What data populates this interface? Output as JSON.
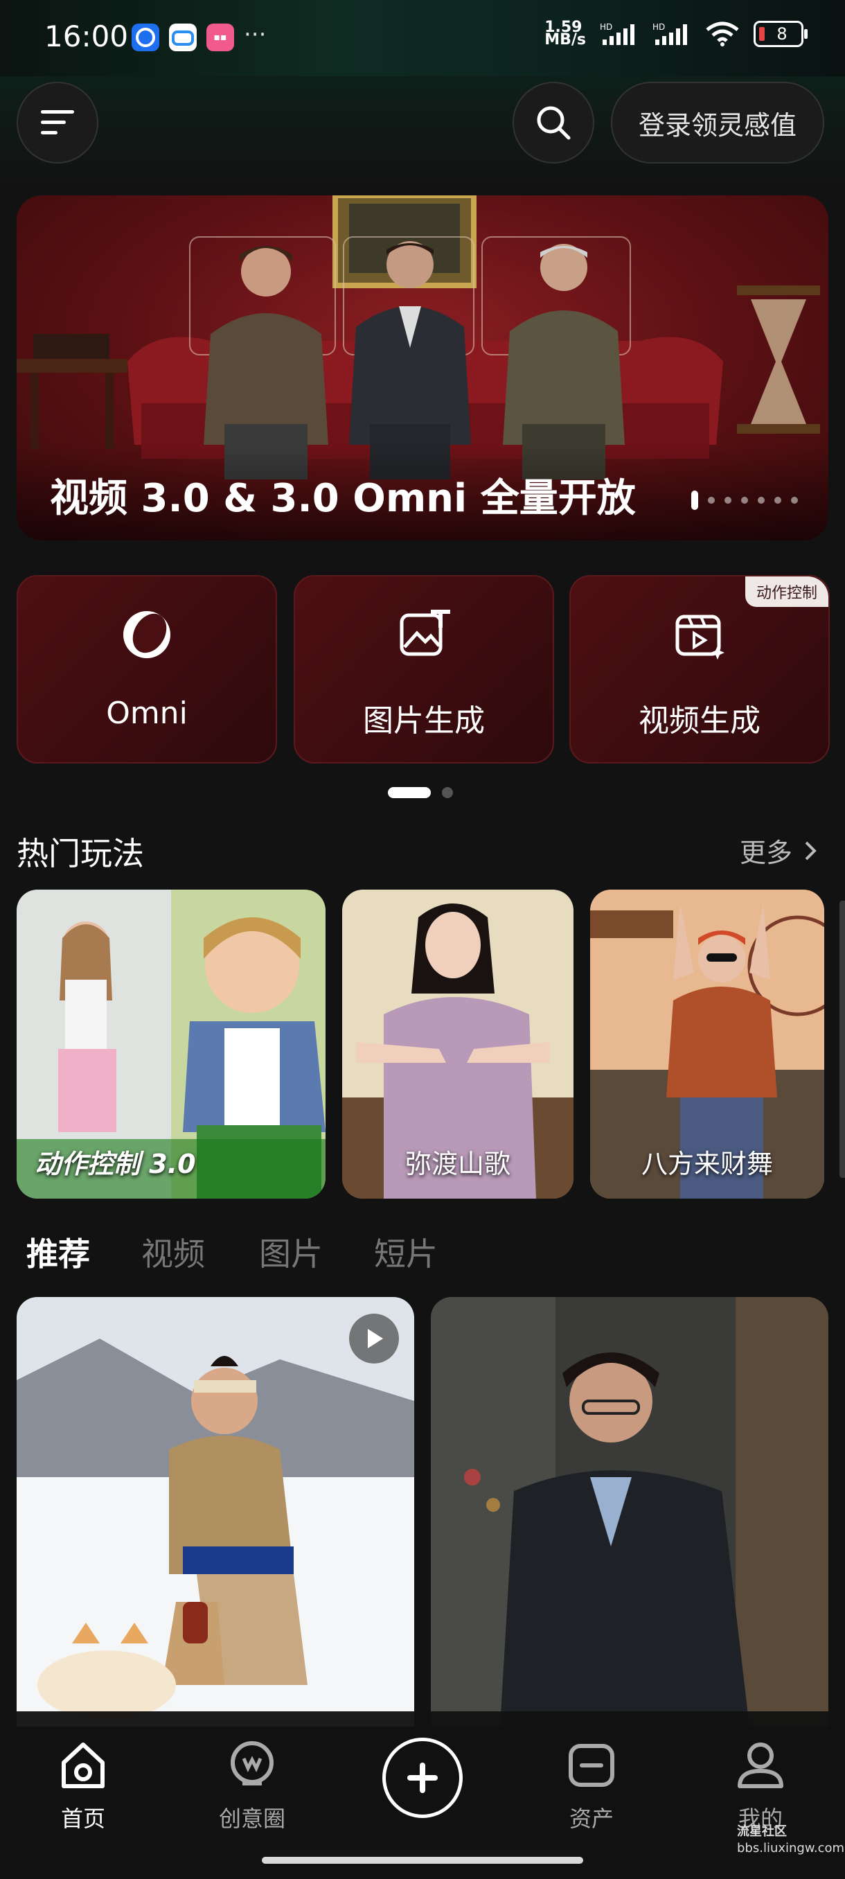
{
  "status": {
    "time": "16:00",
    "more": "···",
    "net_speed": "1.59\nMB/s",
    "hd1": "HD",
    "hd2": "HD",
    "battery": "8"
  },
  "header": {
    "login_label": "登录领灵感值"
  },
  "banner": {
    "title": "视频 3.0 & 3.0 Omni 全量开放",
    "slide_count": 7,
    "active_slide": 1
  },
  "cards": [
    {
      "label": "Omni",
      "icon": "omni-logo-icon"
    },
    {
      "label": "图片生成",
      "icon": "image-generate-icon"
    },
    {
      "label": "视频生成",
      "icon": "video-generate-icon",
      "badge": "动作控制"
    }
  ],
  "cards_pages": 2,
  "hot": {
    "title": "热门玩法",
    "more_label": "更多",
    "items": [
      {
        "label": "动作控制 3.0"
      },
      {
        "label": "弥渡山歌"
      },
      {
        "label": "八方来财舞"
      }
    ]
  },
  "tabs": [
    "推荐",
    "视频",
    "图片",
    "短片"
  ],
  "nav": [
    {
      "label": "首页",
      "icon": "home-icon"
    },
    {
      "label": "创意圈",
      "icon": "community-icon"
    },
    {
      "label": "",
      "icon": "plus-circle-icon"
    },
    {
      "label": "资产",
      "icon": "folder-icon"
    },
    {
      "label": "我的",
      "icon": "profile-icon"
    }
  ],
  "watermark": {
    "line1": "流星社区",
    "line2": "bbs.liuxingw.com"
  },
  "colors": {
    "accent_card": "#4e0f13",
    "background": "#121212"
  }
}
